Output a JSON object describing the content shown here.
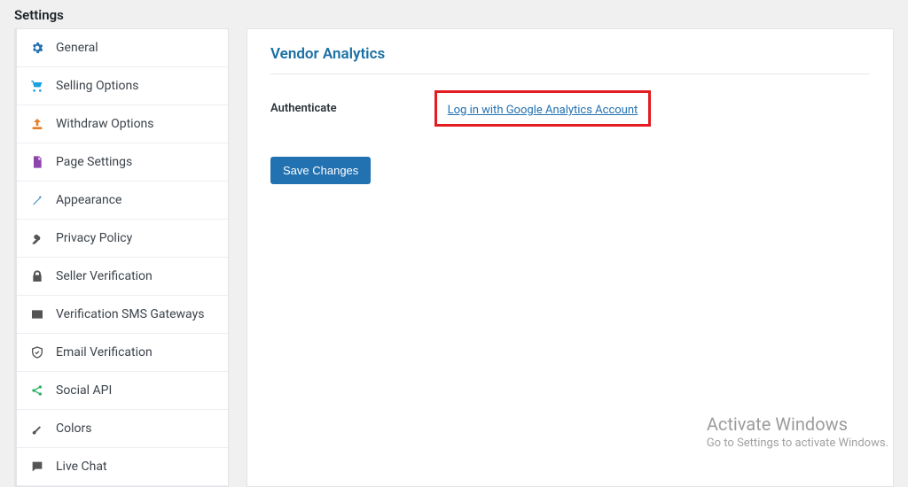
{
  "header": {
    "title": "Settings"
  },
  "sidebar": {
    "items": [
      {
        "label": "General"
      },
      {
        "label": "Selling Options"
      },
      {
        "label": "Withdraw Options"
      },
      {
        "label": "Page Settings"
      },
      {
        "label": "Appearance"
      },
      {
        "label": "Privacy Policy"
      },
      {
        "label": "Seller Verification"
      },
      {
        "label": "Verification SMS Gateways"
      },
      {
        "label": "Email Verification"
      },
      {
        "label": "Social API"
      },
      {
        "label": "Colors"
      },
      {
        "label": "Live Chat"
      }
    ]
  },
  "panel": {
    "title": "Vendor Analytics",
    "auth_label": "Authenticate",
    "auth_link": "Log in with Google Analytics Account",
    "save_label": "Save Changes"
  },
  "watermark": {
    "title": "Activate Windows",
    "sub": "Go to Settings to activate Windows."
  },
  "colors": {
    "accent": "#2271b1",
    "highlight_border": "#e21c21"
  }
}
